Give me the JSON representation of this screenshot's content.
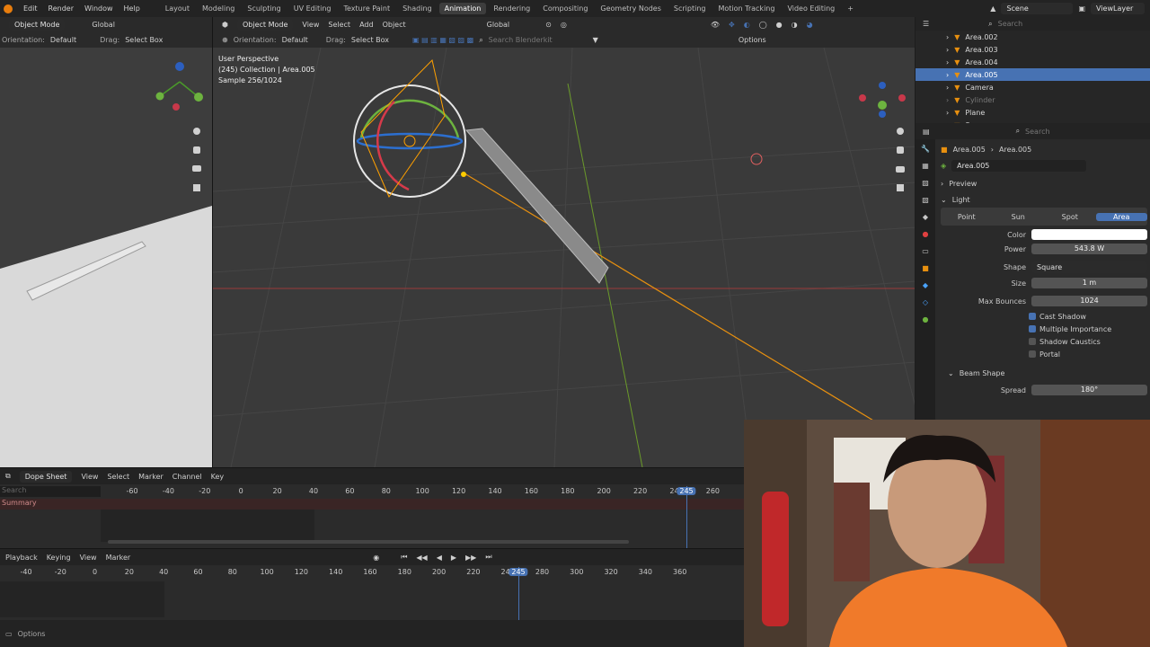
{
  "menu": [
    "Edit",
    "Render",
    "Window",
    "Help"
  ],
  "workspaces": [
    "Layout",
    "Modeling",
    "Sculpting",
    "UV Editing",
    "Texture Paint",
    "Shading",
    "Animation",
    "Rendering",
    "Compositing",
    "Geometry Nodes",
    "Scripting",
    "Motion Tracking",
    "Video Editing"
  ],
  "active_workspace": "Animation",
  "scene": "Scene",
  "view_layer": "ViewLayer",
  "left_viewport": {
    "mode": "Object Mode",
    "orientation": "Global",
    "orientation_label": "Orientation:",
    "orientation_value": "Default",
    "drag_label": "Drag:",
    "drag_value": "Select Box"
  },
  "main_viewport": {
    "mode": "Object Mode",
    "menus": [
      "View",
      "Select",
      "Add",
      "Object"
    ],
    "orientation": "Global",
    "orientation_label": "Orientation:",
    "orientation_value": "Default",
    "drag_label": "Drag:",
    "drag_value": "Select Box",
    "search_placeholder": "Search Blenderkit",
    "options": "Options",
    "overlay_line1": "User Perspective",
    "overlay_line2": "(245) Collection | Area.005",
    "overlay_line3": "Sample 256/1024"
  },
  "outliner": {
    "search_placeholder": "Search",
    "items": [
      {
        "name": "Area.002",
        "selected": false,
        "dim": false
      },
      {
        "name": "Area.003",
        "selected": false,
        "dim": false
      },
      {
        "name": "Area.004",
        "selected": false,
        "dim": false
      },
      {
        "name": "Area.005",
        "selected": true,
        "dim": false
      },
      {
        "name": "Camera",
        "selected": false,
        "dim": false
      },
      {
        "name": "Cylinder",
        "selected": false,
        "dim": true
      },
      {
        "name": "Plane",
        "selected": false,
        "dim": false
      },
      {
        "name": "Sun",
        "selected": false,
        "dim": false
      }
    ]
  },
  "properties": {
    "search_placeholder": "Search",
    "breadcrumb_object": "Area.005",
    "breadcrumb_data": "Area.005",
    "data_name": "Area.005",
    "preview_label": "Preview",
    "light_label": "Light",
    "light_types": [
      "Point",
      "Sun",
      "Spot",
      "Area"
    ],
    "color_label": "Color",
    "power_label": "Power",
    "power_value": "543.8 W",
    "shape_label": "Shape",
    "shape_value": "Square",
    "size_label": "Size",
    "size_value": "1 m",
    "max_bounces_label": "Max Bounces",
    "max_bounces_value": "1024",
    "checks": [
      {
        "label": "Cast Shadow",
        "on": true
      },
      {
        "label": "Multiple Importance",
        "on": true
      },
      {
        "label": "Shadow Caustics",
        "on": false
      },
      {
        "label": "Portal",
        "on": false
      }
    ],
    "beam_shape_label": "Beam Shape",
    "spread_label": "Spread",
    "spread_value": "180°"
  },
  "dope_sheet": {
    "editor": "Dope Sheet",
    "menus": [
      "View",
      "Select",
      "Marker",
      "Channel",
      "Key"
    ],
    "search_placeholder": "Search",
    "channel": "Summary",
    "ruler": [
      "-60",
      "-40",
      "-20",
      "0",
      "20",
      "40",
      "60",
      "80",
      "100",
      "120",
      "140",
      "160",
      "180",
      "200",
      "220",
      "240",
      "260"
    ],
    "current_frame": "245"
  },
  "timeline": {
    "menus": [
      "Playback",
      "Keying",
      "View",
      "Marker"
    ],
    "ruler": [
      "-40",
      "-20",
      "0",
      "20",
      "40",
      "60",
      "80",
      "100",
      "120",
      "140",
      "160",
      "180",
      "200",
      "220",
      "240",
      "280",
      "300",
      "320",
      "340",
      "360"
    ],
    "current_frame": "245"
  },
  "status": {
    "options": "Options"
  },
  "colors": {
    "accent": "#4772b3",
    "active_tab": "#3d3d3d",
    "light_orange": "#ffa000"
  }
}
